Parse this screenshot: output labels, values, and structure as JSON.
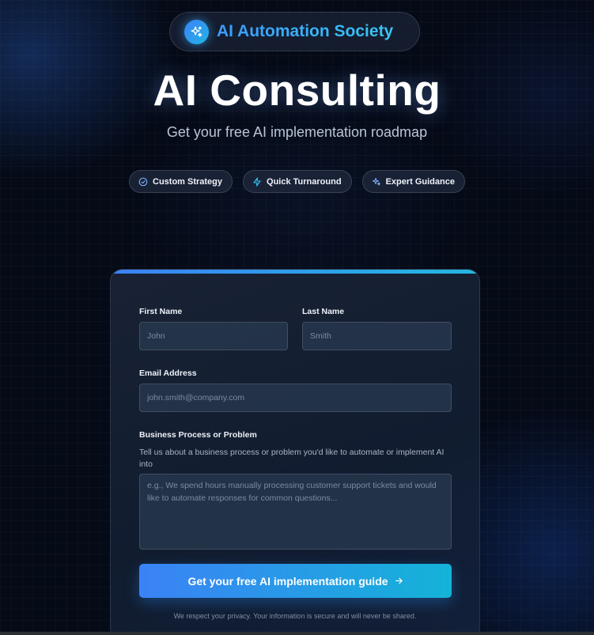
{
  "brand": {
    "name": "AI Automation Society",
    "icon": "sparkles-icon"
  },
  "hero": {
    "title": "AI Consulting",
    "subtitle": "Get your free AI implementation roadmap"
  },
  "features": [
    {
      "label": "Custom Strategy",
      "icon": "check-circle-icon"
    },
    {
      "label": "Quick Turnaround",
      "icon": "lightning-icon"
    },
    {
      "label": "Expert Guidance",
      "icon": "sparkles-icon"
    }
  ],
  "form": {
    "first_name": {
      "label": "First Name",
      "placeholder": "John",
      "value": ""
    },
    "last_name": {
      "label": "Last Name",
      "placeholder": "Smith",
      "value": ""
    },
    "email": {
      "label": "Email Address",
      "placeholder": "john.smith@company.com",
      "value": ""
    },
    "problem": {
      "label": "Business Process or Problem",
      "hint": "Tell us about a business process or problem you'd like to automate or implement AI into",
      "placeholder": "e.g., We spend hours manually processing customer support tickets and would like to automate responses for common questions...",
      "value": ""
    },
    "submit_label": "Get your free AI implementation guide",
    "privacy_note": "We respect your privacy. Your information is secure and will never be shared."
  },
  "colors": {
    "accent_start": "#3b82f6",
    "accent_end": "#14b3d8",
    "background": "#050a17"
  }
}
